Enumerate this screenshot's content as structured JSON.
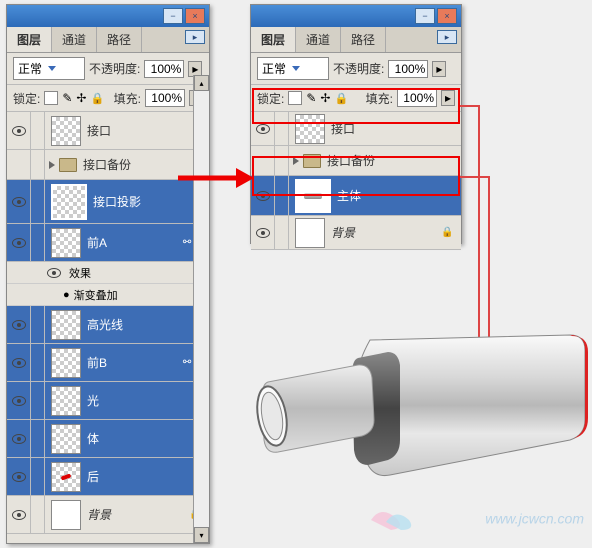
{
  "panelLeft": {
    "tabs": [
      "图层",
      "通道",
      "路径"
    ],
    "activeTab": 0,
    "blendMode": "正常",
    "opacityLabel": "不透明度:",
    "opacityValue": "100%",
    "lockLabel": "锁定:",
    "fillLabel": "填充:",
    "fillValue": "100%",
    "layers": [
      {
        "name": "接口",
        "selected": false,
        "thumb": "checker"
      },
      {
        "name": "接口备份",
        "selected": false,
        "group": true
      },
      {
        "name": "接口投影",
        "selected": true,
        "thumb": "checker"
      },
      {
        "name": "前A",
        "selected": true,
        "thumb": "checker",
        "fx": true
      },
      {
        "name": "高光线",
        "selected": true,
        "thumb": "checker"
      },
      {
        "name": "前B",
        "selected": true,
        "thumb": "checker",
        "fx": true
      },
      {
        "name": "光",
        "selected": true,
        "thumb": "checker"
      },
      {
        "name": "体",
        "selected": true,
        "thumb": "checker"
      },
      {
        "name": "后",
        "selected": true,
        "thumb": "checker-red"
      },
      {
        "name": "背景",
        "selected": false,
        "thumb": "white",
        "locked": true
      }
    ],
    "effects": {
      "label": "效果",
      "item": "渐变叠加"
    }
  },
  "panelRight": {
    "tabs": [
      "图层",
      "通道",
      "路径"
    ],
    "activeTab": 0,
    "blendMode": "正常",
    "opacityLabel": "不透明度:",
    "opacityValue": "100%",
    "lockLabel": "锁定:",
    "fillLabel": "填充:",
    "fillValue": "100%",
    "layers": [
      {
        "name": "接口",
        "selected": false,
        "thumb": "checker"
      },
      {
        "name": "接口备份",
        "selected": false,
        "group": true
      },
      {
        "name": "主体",
        "selected": true,
        "thumb": "usb"
      },
      {
        "name": "背景",
        "selected": false,
        "thumb": "white",
        "locked": true
      }
    ]
  },
  "watermark": "www.jcwcn.com"
}
